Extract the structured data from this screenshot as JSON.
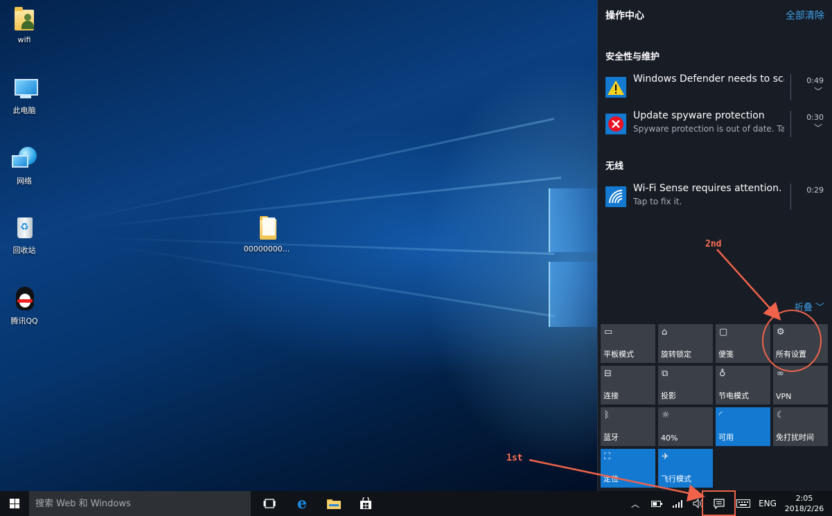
{
  "desktop": {
    "icons": [
      {
        "label": "wifi",
        "icon": "user-folder-icon"
      },
      {
        "label": "此电脑",
        "icon": "computer-icon"
      },
      {
        "label": "网络",
        "icon": "network-icon"
      },
      {
        "label": "回收站",
        "icon": "recycle-bin-icon"
      },
      {
        "label": "腾讯QQ",
        "icon": "qq-penguin-icon"
      },
      {
        "label": "00000000...",
        "icon": "document-folder-icon"
      }
    ]
  },
  "action_center": {
    "title": "操作中心",
    "clear_all": "全部清除",
    "groups": [
      {
        "title": "安全性与维护",
        "notifications": [
          {
            "title": "Windows Defender needs to scan your PC",
            "subtitle": "",
            "time": "0:49",
            "icon": "warning-icon",
            "icon_color": "#f7d21e"
          },
          {
            "title": "Update spyware protection",
            "subtitle": "Spyware protection is out of date. Tap to update.",
            "time": "0:30",
            "icon": "error-icon",
            "icon_color": "#e81123"
          }
        ]
      },
      {
        "title": "无线",
        "notifications": [
          {
            "title": "Wi-Fi Sense requires attention.",
            "subtitle": "Tap to fix it.",
            "time": "0:29",
            "icon": "wifi-icon",
            "icon_color": "#1479d1"
          }
        ]
      }
    ],
    "collapse_label": "折叠",
    "quick_actions": [
      {
        "label": "平板模式",
        "icon": "tablet-mode-icon",
        "on": false
      },
      {
        "label": "旋转锁定",
        "icon": "rotation-lock-icon",
        "on": false
      },
      {
        "label": "便笺",
        "icon": "note-icon",
        "on": false
      },
      {
        "label": "所有设置",
        "icon": "settings-gear-icon",
        "on": false
      },
      {
        "label": "连接",
        "icon": "connect-icon",
        "on": false
      },
      {
        "label": "投影",
        "icon": "project-icon",
        "on": false
      },
      {
        "label": "节电模式",
        "icon": "battery-saver-icon",
        "on": false
      },
      {
        "label": "VPN",
        "icon": "vpn-icon",
        "on": false
      },
      {
        "label": "蓝牙",
        "icon": "bluetooth-icon",
        "on": false
      },
      {
        "label": "40%",
        "icon": "brightness-icon",
        "on": false
      },
      {
        "label": "可用",
        "icon": "wifi-icon",
        "on": true
      },
      {
        "label": "免打扰时间",
        "icon": "quiet-hours-moon-icon",
        "on": false
      },
      {
        "label": "定位",
        "icon": "location-icon",
        "on": true
      },
      {
        "label": "飞行模式",
        "icon": "airplane-icon",
        "on": true
      }
    ],
    "accent_color": "#1479d1"
  },
  "taskbar": {
    "search_placeholder": "搜索 Web 和 Windows",
    "pinned": [
      {
        "name": "task-view-button",
        "icon": "task-view-icon"
      },
      {
        "name": "edge-button",
        "icon": "edge-icon"
      },
      {
        "name": "file-explorer-button",
        "icon": "folder-icon"
      },
      {
        "name": "store-button",
        "icon": "store-icon"
      }
    ],
    "tray": {
      "language": "ENG",
      "time": "2:05",
      "date": "2018/2/26"
    }
  },
  "annotations": {
    "first": "1st",
    "second": "2nd",
    "color": "#f0634a"
  }
}
